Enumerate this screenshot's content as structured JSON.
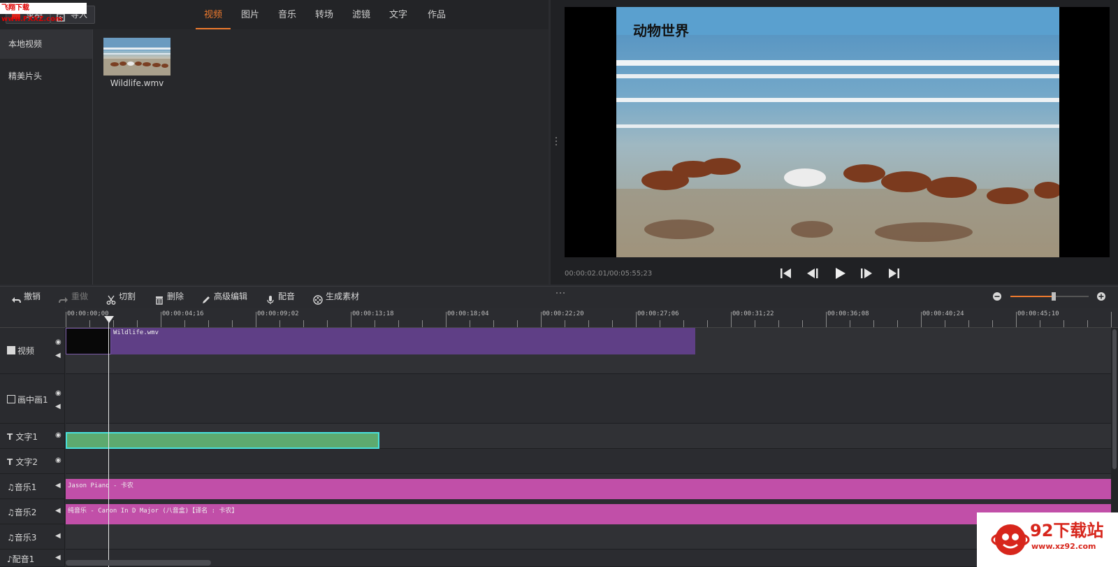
{
  "watermark": "飞翔下载 www.FXXZ.com",
  "toolbar": {
    "record_label": "录制",
    "import_label": "导入"
  },
  "tabs": [
    {
      "label": "视频",
      "active": true
    },
    {
      "label": "图片"
    },
    {
      "label": "音乐"
    },
    {
      "label": "转场"
    },
    {
      "label": "滤镜"
    },
    {
      "label": "文字"
    },
    {
      "label": "作品"
    }
  ],
  "sidebar": {
    "items": [
      {
        "label": "本地视频",
        "active": true
      },
      {
        "label": "精美片头"
      }
    ]
  },
  "media": {
    "items": [
      {
        "name": "Wildlife.wmv"
      }
    ]
  },
  "preview": {
    "overlay_title": "动物世界",
    "timecode": "00:00:02.01/00:05:55;23"
  },
  "edit_toolbar": {
    "undo": "撤销",
    "redo": "重做",
    "cut": "切割",
    "delete": "删除",
    "advanced_edit": "高级编辑",
    "dub": "配音",
    "generate": "生成素材"
  },
  "zoom": {
    "level": 0.55
  },
  "ruler": {
    "ticks": [
      "00:00:00;00",
      "00:00:04;16",
      "00:00:09;02",
      "00:00:13;18",
      "00:00:18;04",
      "00:00:22;20",
      "00:00:27;06",
      "00:00:31;22",
      "00:00:36;08",
      "00:00:40;24",
      "00:00:45;10"
    ]
  },
  "tracks": [
    {
      "label": "视频"
    },
    {
      "label": "画中画1"
    },
    {
      "label": "文字1"
    },
    {
      "label": "文字2"
    },
    {
      "label": "音乐1"
    },
    {
      "label": "音乐2"
    },
    {
      "label": "音乐3"
    },
    {
      "label": "配音1"
    }
  ],
  "clips": {
    "video": "Wildlife.wmv",
    "music1": "Jason Piano - 卡农",
    "music2": "纯音乐 - Canon In D Major (八音盒)【译名 : 卡农】"
  },
  "logo": {
    "text": "92下载站",
    "url": "www.xz92.com"
  },
  "colors": {
    "accent": "#ee7a2e",
    "video_clip": "#5f3f86",
    "text_clip": "#5daa6f",
    "music_clip": "#c14fa8"
  }
}
